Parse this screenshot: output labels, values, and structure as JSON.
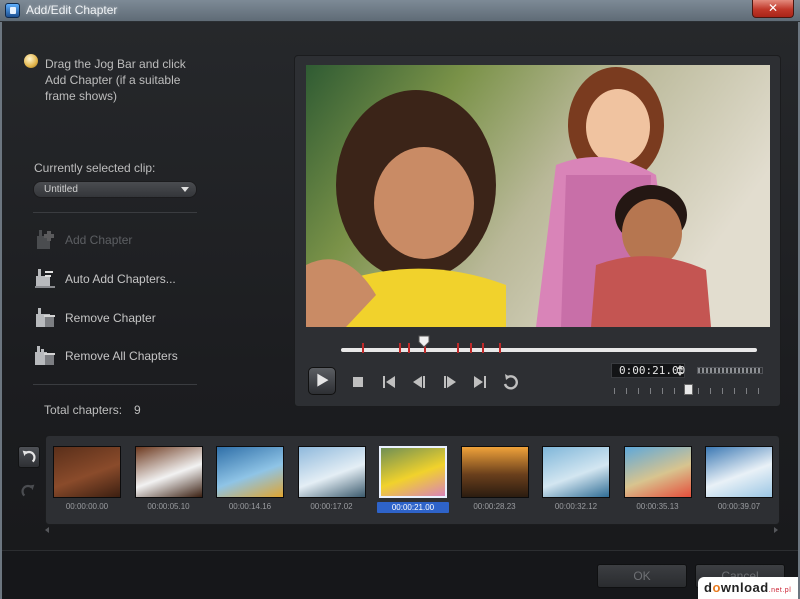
{
  "window": {
    "title": "Add/Edit Chapter",
    "close_glyph": "✕"
  },
  "hint": {
    "text": "Drag the Jog Bar and click Add Chapter (if a suitable frame shows)",
    "icon": "lightbulb-icon"
  },
  "clip": {
    "label": "Currently selected clip:",
    "selected": "Untitled"
  },
  "actions": [
    {
      "label": "Add Chapter",
      "icon": "add-chapter-icon",
      "enabled": false
    },
    {
      "label": "Auto Add Chapters...",
      "icon": "auto-add-chapters-icon",
      "enabled": true
    },
    {
      "label": "Remove Chapter",
      "icon": "remove-chapter-icon",
      "enabled": true
    },
    {
      "label": "Remove All Chapters",
      "icon": "remove-all-chapters-icon",
      "enabled": true
    }
  ],
  "total": {
    "label": "Total chapters:",
    "value": "9"
  },
  "player": {
    "timecode": "0:00:21.00",
    "position": 0.2,
    "chapter_marks": [
      0.05,
      0.14,
      0.16,
      0.2,
      0.28,
      0.31,
      0.34,
      0.38
    ]
  },
  "chapters": [
    {
      "time": "00:00:00.00",
      "thumb": "wood"
    },
    {
      "time": "00:00:05.10",
      "thumb": "photos"
    },
    {
      "time": "00:00:14.16",
      "thumb": "kayak"
    },
    {
      "time": "00:00:17.02",
      "thumb": "lake"
    },
    {
      "time": "00:00:21.00",
      "thumb": "kids",
      "selected": true
    },
    {
      "time": "00:00:28.23",
      "thumb": "sunset"
    },
    {
      "time": "00:00:32.12",
      "thumb": "surf"
    },
    {
      "time": "00:00:35.13",
      "thumb": "beach"
    },
    {
      "time": "00:00:39.07",
      "thumb": "wave"
    }
  ],
  "buttons": {
    "ok": "OK",
    "cancel": "Cancel"
  },
  "watermark": {
    "prefix": "d",
    "o": "o",
    "rest": "wnload",
    "tld": ".net.pl"
  },
  "colors": {
    "selection": "#2e63c9",
    "chapter_mark": "#c02a2a",
    "background": "#1c1d20"
  }
}
